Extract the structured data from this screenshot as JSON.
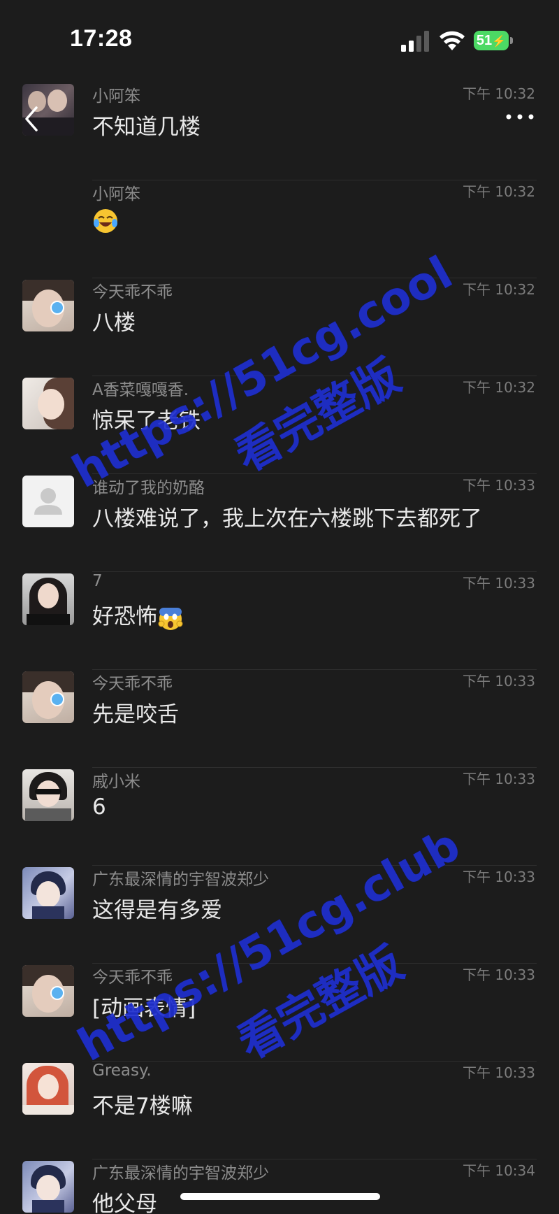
{
  "status_bar": {
    "time": "17:28",
    "battery": "51"
  },
  "messages": [
    {
      "sender": "小阿笨",
      "time": "下午 10:32",
      "text": "不知道几楼",
      "avatar": "couple-photo",
      "show_avatar": true
    },
    {
      "sender": "小阿笨",
      "time": "下午 10:32",
      "text": "",
      "emoji": "crying-laughing-emoji",
      "show_avatar": false
    },
    {
      "sender": "今天乖不乖",
      "time": "下午 10:32",
      "text": "八楼",
      "avatar": "girl-blue-eye"
    },
    {
      "sender": "A香菜嘎嘎香.",
      "time": "下午 10:32",
      "text": "惊呆了老铁",
      "avatar": "girl-light"
    },
    {
      "sender": "谁动了我的奶酪",
      "time": "下午 10:33",
      "text": "八楼难说了，我上次在六楼跳下去都死了",
      "avatar": "default-gray"
    },
    {
      "sender": "7",
      "time": "下午 10:33",
      "text": "好恐怖",
      "emoji": "screaming-emoji",
      "avatar": "girl-dark-hair"
    },
    {
      "sender": "今天乖不乖",
      "time": "下午 10:33",
      "text": "先是咬舌",
      "avatar": "girl-blue-eye"
    },
    {
      "sender": "戚小米",
      "time": "下午 10:33",
      "text": "6",
      "avatar": "girl-sunglasses"
    },
    {
      "sender": "广东最深情的宇智波郑少",
      "time": "下午 10:33",
      "text": "这得是有多爱",
      "avatar": "anime-boy"
    },
    {
      "sender": "今天乖不乖",
      "time": "下午 10:33",
      "text": "[动画表情]",
      "avatar": "girl-blue-eye"
    },
    {
      "sender": "Greasy.",
      "time": "下午 10:33",
      "text": "不是7楼嘛",
      "avatar": "girl-red-hair"
    },
    {
      "sender": "广东最深情的宇智波郑少",
      "time": "下午 10:34",
      "text": "他父母",
      "avatar": "anime-boy"
    }
  ],
  "watermarks": [
    {
      "url": "https://51cg.cool",
      "caption": "看完整版"
    },
    {
      "url": "https://51cg.club",
      "caption": "看完整版"
    }
  ],
  "colors": {
    "background": "#1c1c1c",
    "watermark": "#1f2fd0",
    "battery": "#4cd964"
  }
}
